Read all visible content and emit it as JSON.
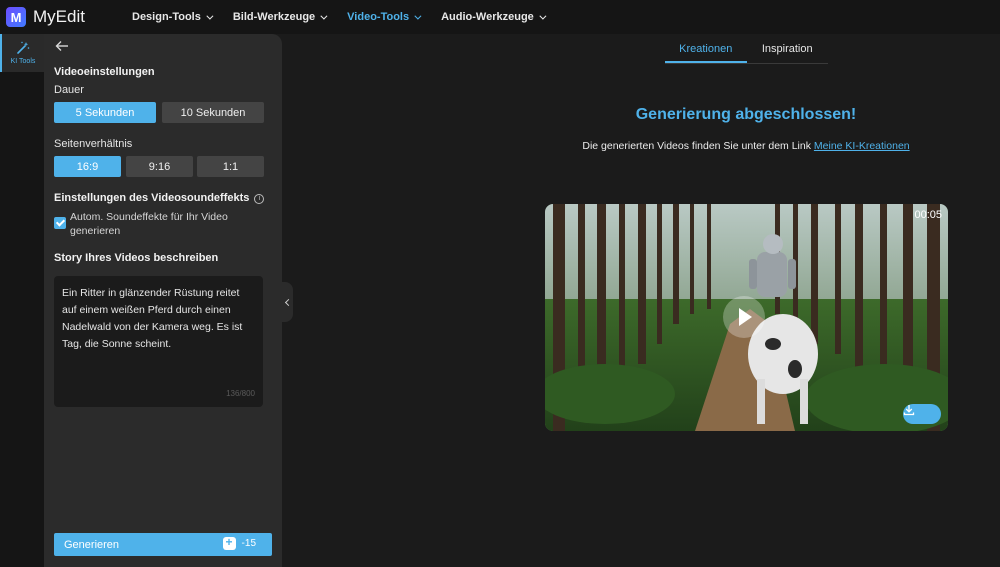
{
  "app": {
    "name": "MyEdit",
    "logo_letter": "M"
  },
  "nav": [
    {
      "label": "Design-Tools",
      "active": false
    },
    {
      "label": "Bild-Werkzeuge",
      "active": false
    },
    {
      "label": "Video-Tools",
      "active": true
    },
    {
      "label": "Audio-Werkzeuge",
      "active": false
    }
  ],
  "rail": {
    "ki_tools_label": "KI Tools"
  },
  "panel": {
    "video_settings_title": "Videoeinstellungen",
    "duration_label": "Dauer",
    "duration_options": [
      "5 Sekunden",
      "10 Sekunden"
    ],
    "duration_selected": "5 Sekunden",
    "aspect_label": "Seitenverhältnis",
    "aspect_options": [
      "16:9",
      "9:16",
      "1:1"
    ],
    "aspect_selected": "16:9",
    "sound_title": "Einstellungen des Videosoundeffekts",
    "sound_checkbox_label": "Autom. Soundeffekte für Ihr Video generieren",
    "sound_checked": true,
    "story_title": "Story Ihres Videos beschreiben",
    "story_text": "Ein Ritter in glänzender Rüstung reitet auf einem weißen Pferd durch einen Nadelwald von der Kamera weg. Es ist Tag, die Sonne scheint.",
    "char_count": "136/800",
    "generate_label": "Generieren",
    "credit_cost": "-15"
  },
  "main": {
    "tabs": [
      "Kreationen",
      "Inspiration"
    ],
    "active_tab": "Kreationen",
    "headline": "Generierung abgeschlossen!",
    "subline": "Die generierten Videos finden Sie unter dem Link",
    "link_text": "Meine KI-Kreationen",
    "video_duration": "00:05"
  },
  "colors": {
    "accent": "#4fb2ea",
    "panel": "#2b2b2b",
    "background": "#1b1b1b"
  }
}
